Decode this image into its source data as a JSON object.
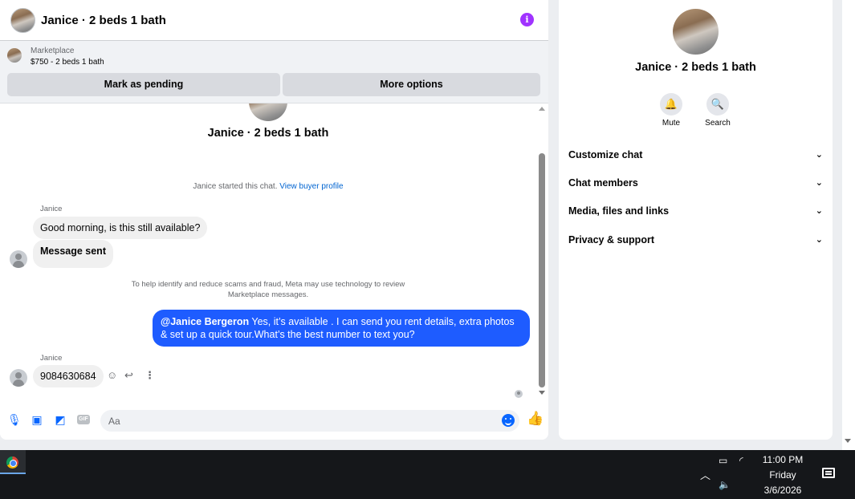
{
  "chat": {
    "title": "Janice · 2 beds 1 bath",
    "listing": {
      "category": "Marketplace",
      "price_line": "$750 - 2 beds 1 bath"
    },
    "buttons": {
      "mark_pending": "Mark as pending",
      "more_options": "More options"
    },
    "intro_title": "Janice · 2 beds 1 bath",
    "started_text": "Janice started this chat.",
    "started_link": "View buyer profile",
    "messages": [
      {
        "sender": "Janice",
        "text": "Good morning, is this still available?"
      },
      {
        "text": "Message sent"
      }
    ],
    "notice": "To help identify and reduce scams and fraud, Meta may use technology to review Marketplace messages.",
    "outgoing": {
      "mention": "@Janice Bergeron",
      "text": " Yes, it’s available .  I can send you rent details, extra photos & set up a quick tour.What’s the best number to text you?"
    },
    "last_message": {
      "sender": "Janice",
      "text": "9084630684"
    },
    "composer_placeholder": "Aa"
  },
  "info_panel": {
    "title": "Janice · 2 beds 1 bath",
    "actions": [
      {
        "label": "Mute",
        "icon": "bell-icon"
      },
      {
        "label": "Search",
        "icon": "search-icon"
      }
    ],
    "sections": [
      "Customize chat",
      "Chat members",
      "Media, files and links",
      "Privacy & support"
    ]
  },
  "taskbar": {
    "time": "11:00 PM",
    "day": "Friday",
    "date": "3/6/2026"
  },
  "colors": {
    "accent": "#0866ff",
    "outgoing_bubble": "#1e5cff",
    "info_icon": "#a033ff"
  }
}
